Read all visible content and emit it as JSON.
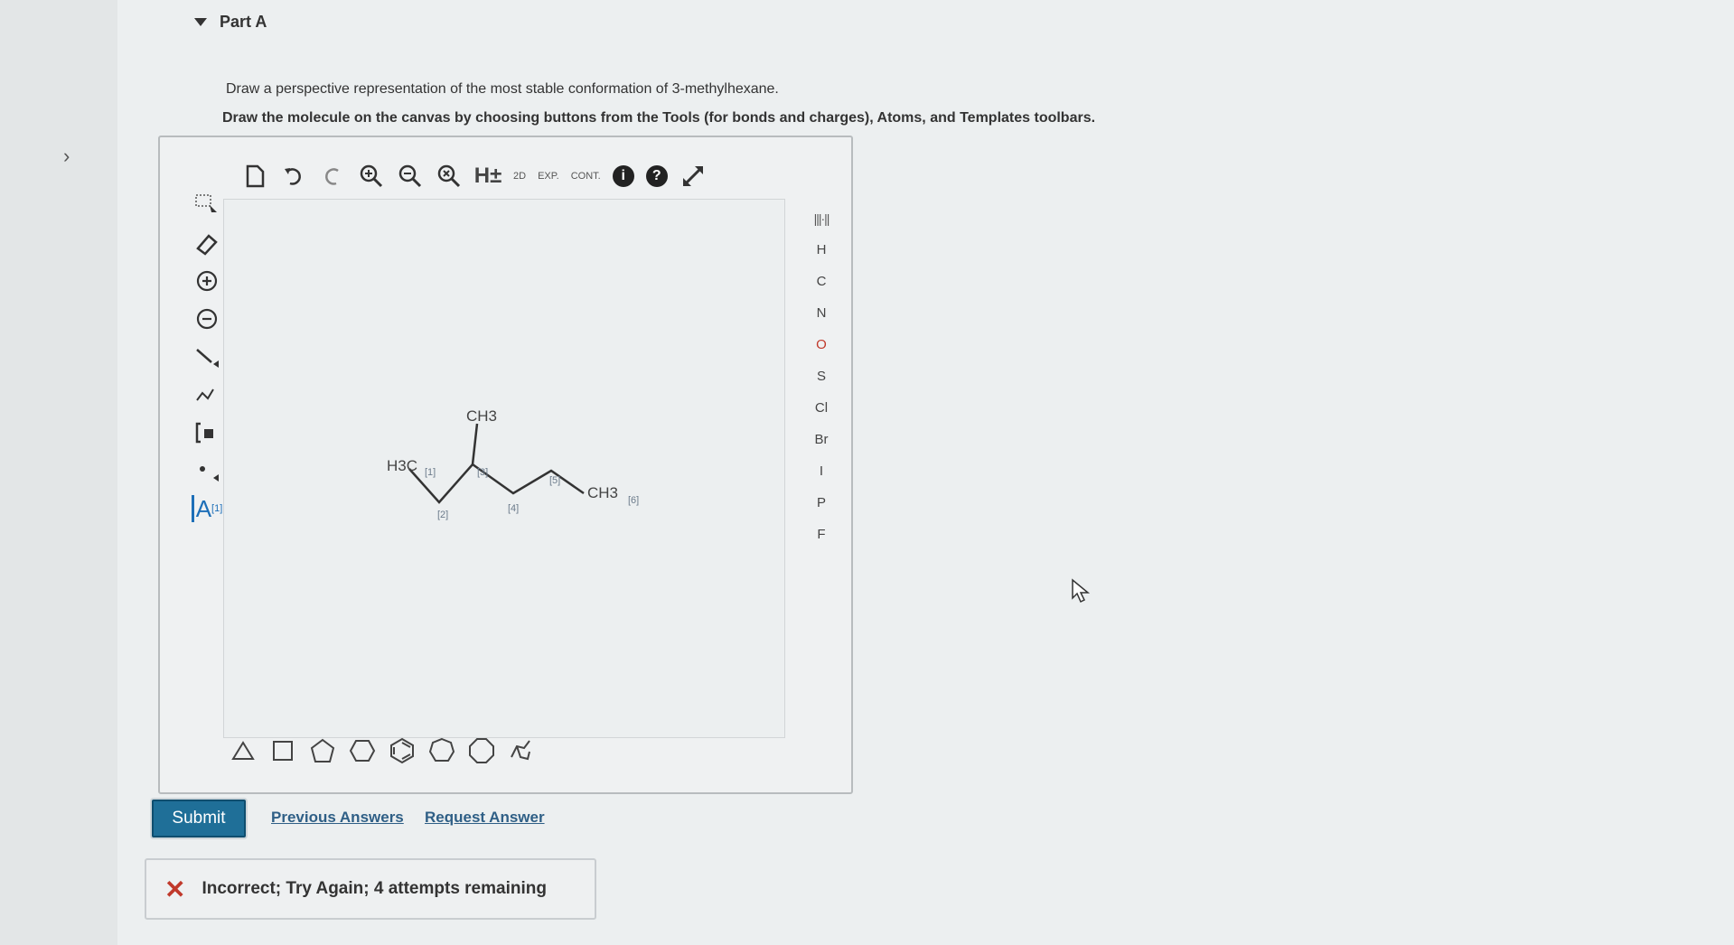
{
  "part": {
    "title": "Part A"
  },
  "instructions": {
    "line1": "Draw a perspective representation of the most stable conformation of 3-methylhexane.",
    "line2": "Draw the molecule on the canvas by choosing buttons from the Tools (for bonds and charges), Atoms, and Templates toolbars."
  },
  "toolbar_top": {
    "h_label": "H±",
    "2d_label": "2D",
    "exp_label": "EXP.",
    "cont_label": "CONT.",
    "info_label": "i",
    "help_label": "?"
  },
  "toolbar_left": {
    "atom_text_label": "A",
    "atom_text_index": "[1]"
  },
  "atoms": [
    "H",
    "C",
    "N",
    "O",
    "S",
    "Cl",
    "Br",
    "I",
    "P",
    "F"
  ],
  "molecule": {
    "labels": {
      "ch3_top": "CH3",
      "h3c_left": "H3C",
      "ch3_right": "CH3"
    },
    "indices": [
      "[1]",
      "[2]",
      "[3]",
      "[4]",
      "[5]",
      "[6]"
    ]
  },
  "actions": {
    "submit": "Submit",
    "previous_answers": "Previous Answers",
    "request_answer": "Request Answer"
  },
  "feedback": {
    "message": "Incorrect; Try Again; 4 attempts remaining"
  }
}
